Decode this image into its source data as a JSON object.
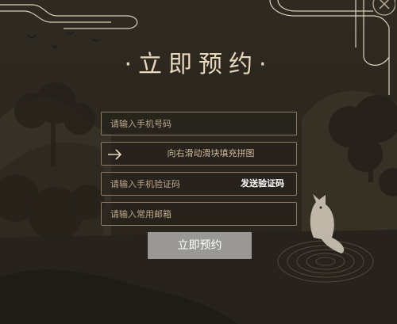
{
  "dialog": {
    "title": "·立即预约·",
    "close_icon": "close-icon"
  },
  "form": {
    "phone_placeholder": "请输入手机号码",
    "slider_label": "向右滑动滑块填充拼图",
    "slider_icon": "arrow-right-icon",
    "code_placeholder": "请输入手机验证码",
    "send_code_label": "发送验证码",
    "email_placeholder": "请输入常用邮箱",
    "submit_label": "立即预约"
  },
  "theme": {
    "title_color": "#e9d8bc",
    "border_color": "#8d7a63",
    "submit_bg": "#9a9895"
  }
}
